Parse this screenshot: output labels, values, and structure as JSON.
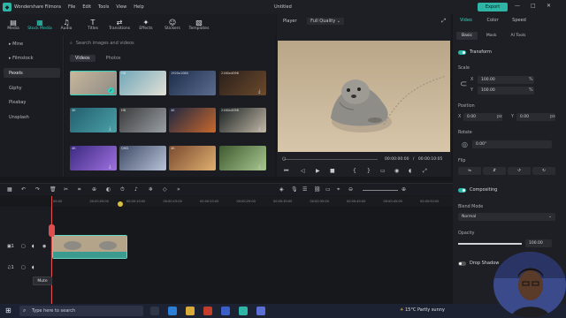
{
  "titlebar": {
    "app_name": "Wondershare Filmora",
    "menu": [
      "File",
      "Edit",
      "Tools",
      "View",
      "Help"
    ],
    "document_title": "Untitled",
    "export_label": "Export"
  },
  "media_tabs": [
    {
      "label": "Media",
      "icon": "film-icon"
    },
    {
      "label": "Stock Media",
      "icon": "stock-media-icon"
    },
    {
      "label": "Audio",
      "icon": "music-note-icon"
    },
    {
      "label": "Titles",
      "icon": "text-icon"
    },
    {
      "label": "Transitions",
      "icon": "transition-icon"
    },
    {
      "label": "Effects",
      "icon": "effects-icon"
    },
    {
      "label": "Stickers",
      "icon": "sticker-icon"
    },
    {
      "label": "Templates",
      "icon": "template-icon"
    }
  ],
  "sidebar": {
    "items": [
      "Mine",
      "Filmstock",
      "Pexels",
      "Giphy",
      "Pixabay",
      "Unsplash"
    ],
    "active": "Pexels"
  },
  "media": {
    "search_placeholder": "Search images and videos",
    "subtabs": [
      "Videos",
      "Photos"
    ],
    "thumb_badges": [
      "",
      "HD",
      "1920x1080",
      "2160x4096",
      "4K",
      "HD",
      "4K",
      "2160x4096",
      "4K",
      "QHD",
      "4K",
      ""
    ]
  },
  "player": {
    "label": "Player",
    "quality": "Full Quality",
    "current_time": "00:00:00:00",
    "total_time": "00:00:10:05"
  },
  "properties": {
    "tabs": [
      "Video",
      "Color",
      "Speed"
    ],
    "subtabs": [
      "Basic",
      "Mask",
      "AI Tools"
    ],
    "transform_label": "Transform",
    "scale_label": "Scale",
    "scale_x": "100.00",
    "scale_y": "100.00",
    "percent_unit": "%",
    "position_label": "Position",
    "pos_x": "0.00",
    "pos_y": "0.00",
    "px_unit": "px",
    "rotate_label": "Rotate",
    "rotate_value": "0.00°",
    "flip_label": "Flip",
    "compositing_label": "Compositing",
    "blend_mode_label": "Blend Mode",
    "blend_mode_value": "Normal",
    "opacity_label": "Opacity",
    "opacity_value": "100.00",
    "opacity_fraction": 1.0,
    "drop_shadow_label": "Drop Shadow"
  },
  "timeline": {
    "ticks": [
      "00:00",
      "00:00:05:00",
      "00:00:10:00",
      "00:00:15:00",
      "00:00:20:00",
      "00:00:25:00",
      "00:00:30:00",
      "00:00:35:00",
      "00:00:40:00",
      "00:00:45:00",
      "00:00:50:00"
    ],
    "tooltip": "Mute"
  },
  "taskbar": {
    "search_placeholder": "Type here to search",
    "weather": "15°C  Partly sunny"
  }
}
